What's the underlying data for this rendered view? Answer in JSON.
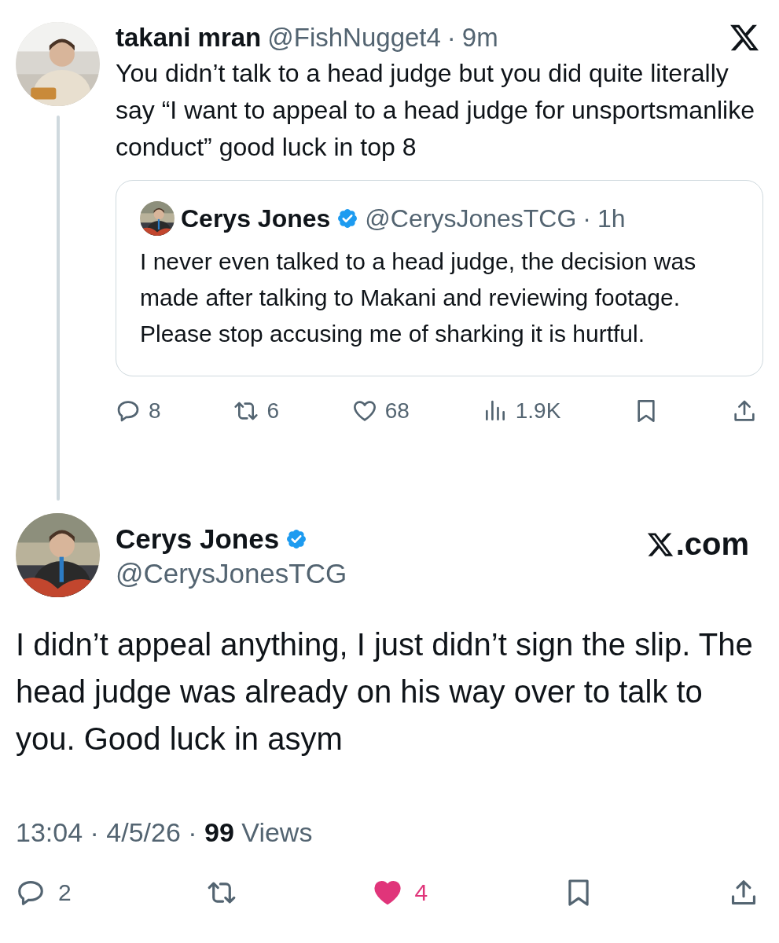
{
  "reply_tweet": {
    "author": "takani mran",
    "handle": "@FishNugget4",
    "separator": "·",
    "time": "9m",
    "text": "You didn’t talk to a head judge but you did quite literally say “I want to appeal to a head judge for unsportsmanlike conduct” good luck in top 8",
    "quoted": {
      "author": "Cerys Jones",
      "verified": true,
      "handle": "@CerysJonesTCG",
      "separator": "·",
      "time": "1h",
      "text": "I never even talked to a head judge, the decision was made after talking to Makani and reviewing footage. Please stop accusing me of sharking it is hurtful."
    },
    "actions": [
      {
        "kind": "reply",
        "count": "8"
      },
      {
        "kind": "repost",
        "count": "6"
      },
      {
        "kind": "like",
        "count": "68",
        "selected": false
      },
      {
        "kind": "views",
        "count": "1.9K"
      },
      {
        "kind": "bookmark"
      },
      {
        "kind": "share"
      }
    ]
  },
  "main_tweet": {
    "author": "Cerys Jones",
    "verified": true,
    "handle": "@CerysJonesTCG",
    "brand_suffix": ".com",
    "text": "I didn’t appeal anything, I just didn’t sign the slip. The head judge was already on his way over to talk to you. Good luck in asym",
    "meta": "13:04 · 4/5/26 · **99** Views",
    "actions": [
      {
        "kind": "reply",
        "count": "2"
      },
      {
        "kind": "repost"
      },
      {
        "kind": "like",
        "count": "4",
        "selected": true
      },
      {
        "kind": "bookmark"
      },
      {
        "kind": "share"
      }
    ]
  }
}
